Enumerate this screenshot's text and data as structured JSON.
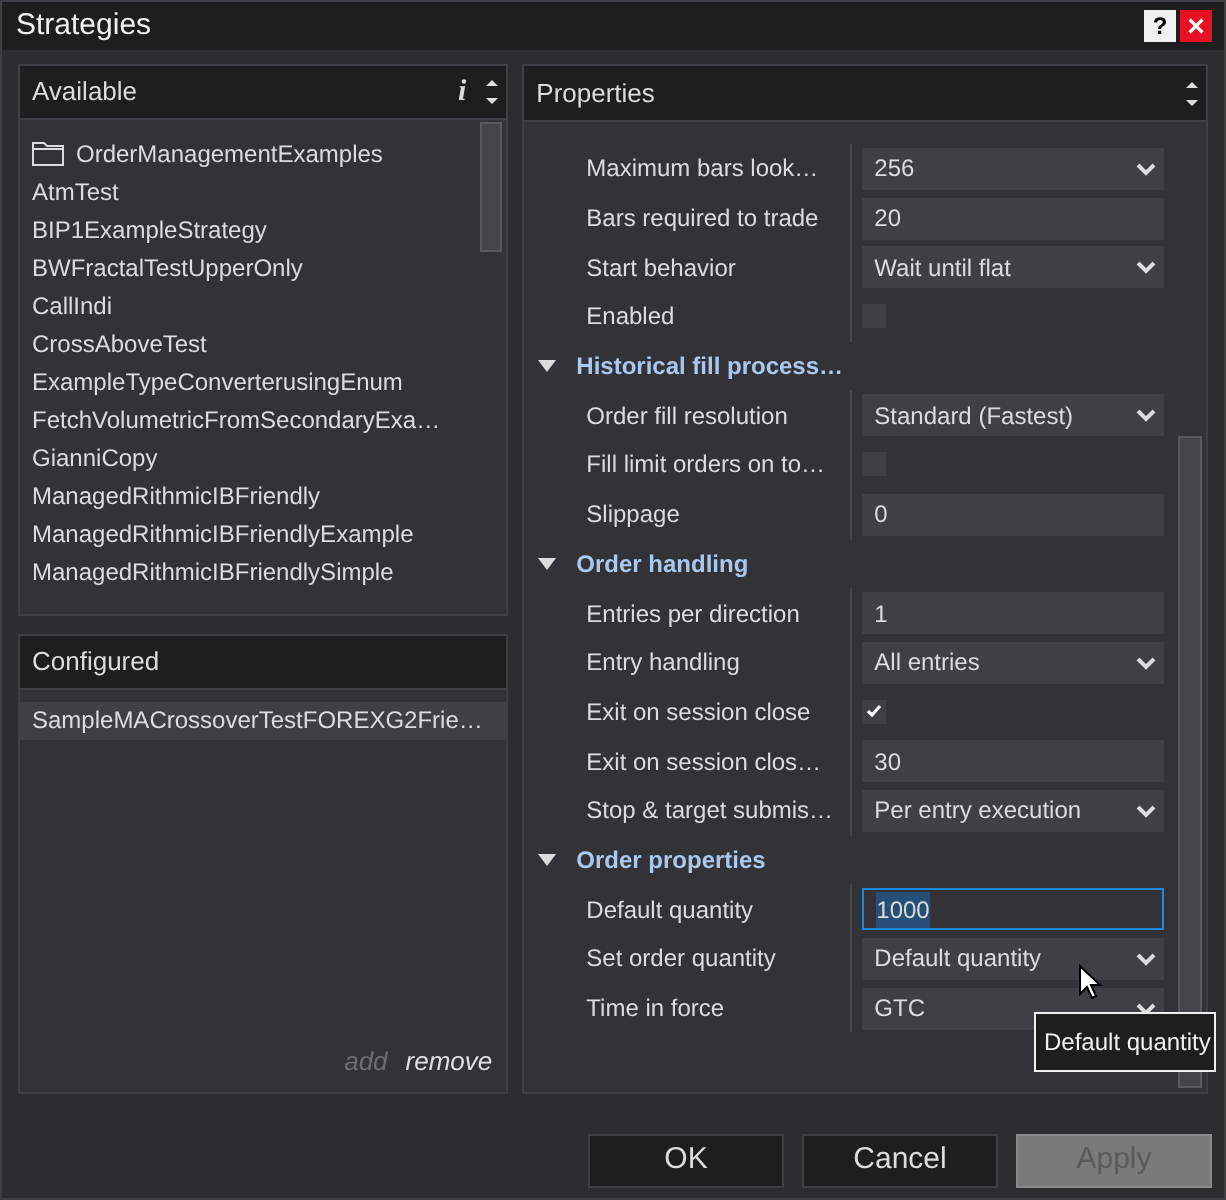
{
  "window": {
    "title": "Strategies",
    "help_button": "?",
    "close_button": "×"
  },
  "available": {
    "header": "Available",
    "info": "i",
    "items": [
      {
        "kind": "folder",
        "label": "OrderManagementExamples"
      },
      {
        "kind": "strategy",
        "label": "AtmTest"
      },
      {
        "kind": "strategy",
        "label": "BIP1ExampleStrategy"
      },
      {
        "kind": "strategy",
        "label": "BWFractalTestUpperOnly"
      },
      {
        "kind": "strategy",
        "label": "CallIndi"
      },
      {
        "kind": "strategy",
        "label": "CrossAboveTest"
      },
      {
        "kind": "strategy",
        "label": "ExampleTypeConverterusingEnum"
      },
      {
        "kind": "strategy",
        "label": "FetchVolumetricFromSecondaryExa…"
      },
      {
        "kind": "strategy",
        "label": "GianniCopy"
      },
      {
        "kind": "strategy",
        "label": "ManagedRithmicIBFriendly"
      },
      {
        "kind": "strategy",
        "label": "ManagedRithmicIBFriendlyExample"
      },
      {
        "kind": "strategy",
        "label": "ManagedRithmicIBFriendlySimple"
      }
    ]
  },
  "configured": {
    "header": "Configured",
    "items": [
      {
        "label": "SampleMACrossoverTestFOREXG2Frie…",
        "selected": true
      }
    ],
    "actions": [
      {
        "label": "add",
        "disabled": true
      },
      {
        "label": "remove",
        "disabled": false
      }
    ]
  },
  "properties": {
    "header": "Properties",
    "rows": [
      {
        "kind": "dropdown",
        "label": "Maximum bars look…",
        "value": "256",
        "focused": false
      },
      {
        "kind": "text",
        "label": "Bars required to trade",
        "value": "20",
        "focused": false
      },
      {
        "kind": "dropdown",
        "label": "Start behavior",
        "value": "Wait until flat",
        "focused": false
      },
      {
        "kind": "checkbox",
        "label": "Enabled",
        "checked": false
      },
      {
        "kind": "category",
        "label": "Historical fill process…",
        "expanded": true
      },
      {
        "kind": "dropdown",
        "label": "Order fill resolution",
        "value": "Standard (Fastest)",
        "focused": false
      },
      {
        "kind": "checkbox",
        "label": "Fill limit orders on to…",
        "checked": false
      },
      {
        "kind": "text",
        "label": "Slippage",
        "value": "0",
        "focused": false
      },
      {
        "kind": "category",
        "label": "Order handling",
        "expanded": true
      },
      {
        "kind": "text",
        "label": "Entries per direction",
        "value": "1",
        "focused": false
      },
      {
        "kind": "dropdown",
        "label": "Entry handling",
        "value": "All entries",
        "focused": false
      },
      {
        "kind": "checkbox",
        "label": "Exit on session close",
        "checked": true
      },
      {
        "kind": "text",
        "label": "Exit on session clos…",
        "value": "30",
        "focused": false
      },
      {
        "kind": "dropdown",
        "label": "Stop & target submis…",
        "value": "Per entry execution",
        "focused": false
      },
      {
        "kind": "category",
        "label": "Order properties",
        "expanded": true
      },
      {
        "kind": "text",
        "label": "Default quantity",
        "value": "1000",
        "focused": true
      },
      {
        "kind": "dropdown",
        "label": "Set order quantity",
        "value": "Default quantity",
        "focused": false
      },
      {
        "kind": "dropdown",
        "label": "Time in force",
        "value": "GTC",
        "focused": false
      }
    ]
  },
  "tooltip": "Default quantity",
  "buttons": [
    {
      "label": "OK",
      "disabled": false
    },
    {
      "label": "Cancel",
      "disabled": false
    },
    {
      "label": "Apply",
      "disabled": true
    }
  ]
}
